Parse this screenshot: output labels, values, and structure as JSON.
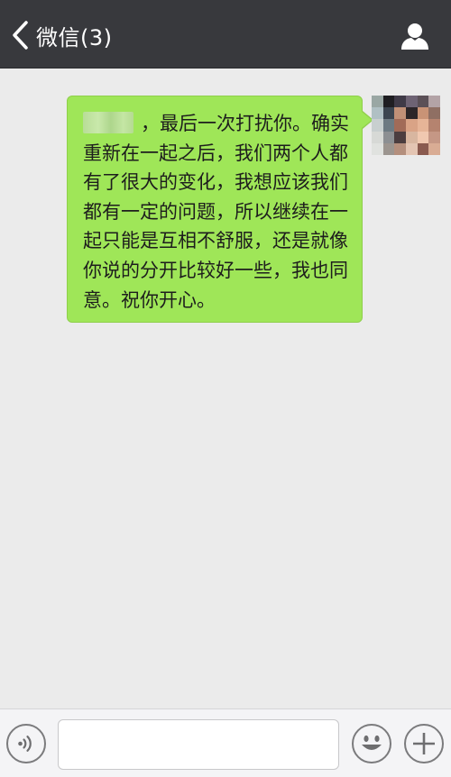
{
  "header": {
    "title": "微信(3)",
    "back_icon": "chevron-left-icon",
    "profile_icon": "person-icon"
  },
  "colors": {
    "header_bg": "#38393d",
    "chat_bg": "#ebebeb",
    "bubble_bg": "#9fe658",
    "bottom_bar_bg": "#f4f4f6"
  },
  "conversation": {
    "messages": [
      {
        "sender": "self",
        "avatar_icon": "pixelated-avatar",
        "name_blurred": true,
        "text": "，最后一次打扰你。确实重新在一起之后，我们两个人都有了很大的变化，我想应该我们都有一定的问题，所以继续在一起只能是互相不舒服，还是就像你说的分开比较好一些，我也同意。祝你开心。"
      }
    ]
  },
  "input_bar": {
    "voice_icon": "voice-icon",
    "input_value": "",
    "input_placeholder": "",
    "emoji_icon": "emoji-icon",
    "plus_icon": "plus-icon"
  }
}
